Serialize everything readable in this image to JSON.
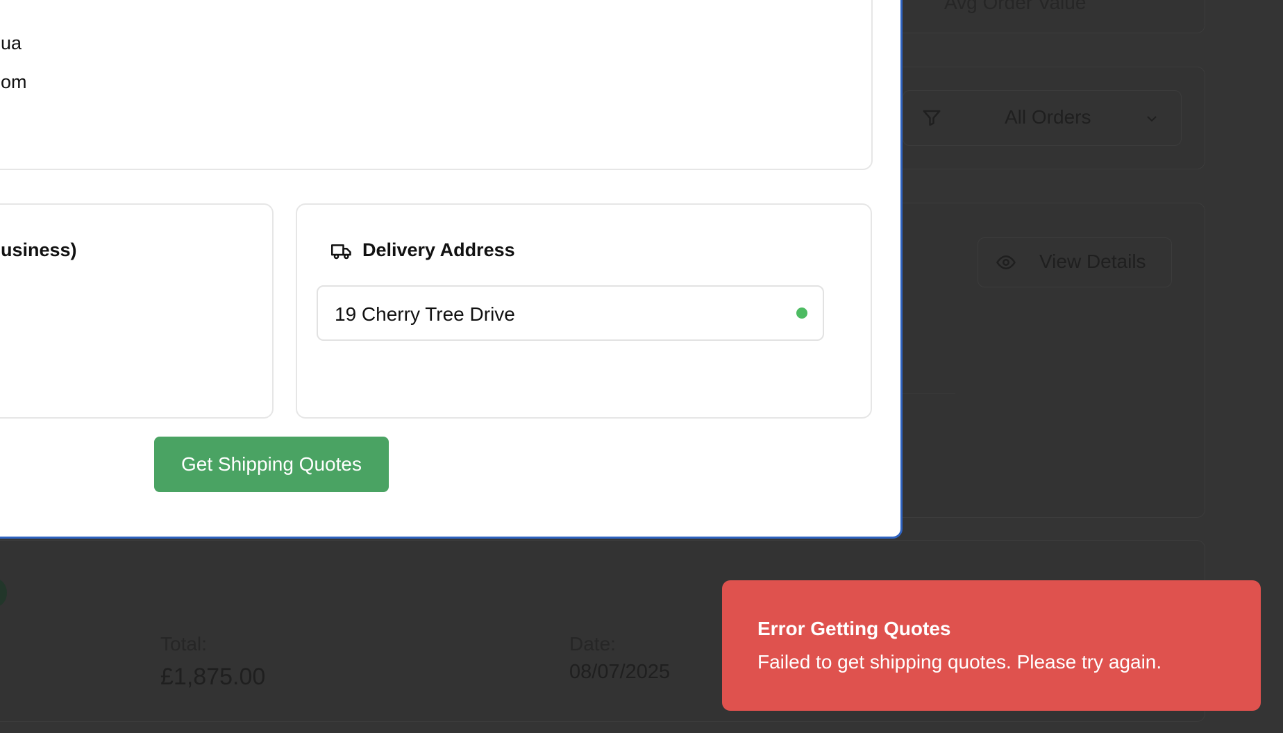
{
  "background": {
    "stat_label": "Avg Order Value",
    "filter": {
      "selected": "All Orders",
      "icon": "filter-icon",
      "chevron_icon": "chevron-down-icon"
    },
    "view_details": {
      "label": "View Details",
      "icon": "eye-icon"
    },
    "order": {
      "total_label": "Total:",
      "total_value": "£1,875.00",
      "date_label": "Date:",
      "date_value": "08/07/2025"
    }
  },
  "modal": {
    "customer_partial_line1": "ua",
    "customer_partial_line2": "om",
    "billing_title_partial": "usiness)",
    "delivery": {
      "title": "Delivery Address",
      "icon": "truck-icon",
      "address": "19 Cherry Tree Drive",
      "status_color": "#4dbb62"
    },
    "get_quotes_label": "Get Shipping Quotes"
  },
  "toast": {
    "title": "Error Getting Quotes",
    "message": "Failed to get shipping quotes. Please try again.",
    "color": "#df524e"
  },
  "colors": {
    "modal_border": "#2f63c0",
    "button": "#4aa363",
    "overlay": "#333333"
  }
}
